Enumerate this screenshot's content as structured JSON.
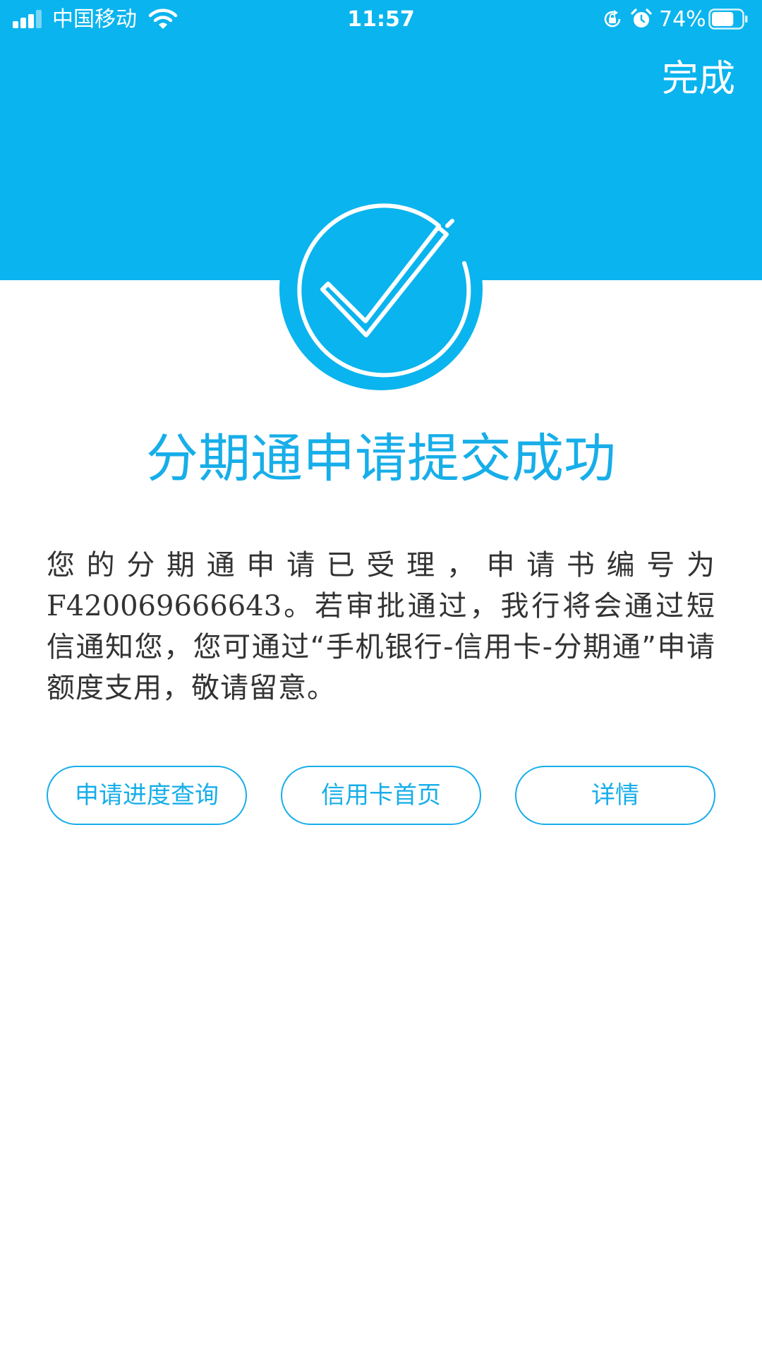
{
  "status_bar": {
    "carrier": "中国移动",
    "time": "11:57",
    "battery_percent": "74%",
    "battery_level": 0.74,
    "icons": [
      "signal-icon",
      "wifi-icon",
      "rotation-lock-icon",
      "alarm-icon",
      "battery-icon"
    ]
  },
  "header": {
    "done_label": "完成",
    "background_color": "#0ab4ee"
  },
  "result": {
    "icon": "check-circle-icon",
    "title": "分期通申请提交成功",
    "message_before": "您的分期通申请已受理，申请书编号为",
    "application_number": "F420069666643",
    "message_after": "。若审批通过，我行将会通过短信通知您，您可通过“手机银行-信用卡-分期通”申请额度支用，敬请留意。",
    "accent_color": "#17aee9"
  },
  "actions": {
    "progress_label": "申请进度查询",
    "card_home_label": "信用卡首页",
    "details_label": "详情"
  }
}
